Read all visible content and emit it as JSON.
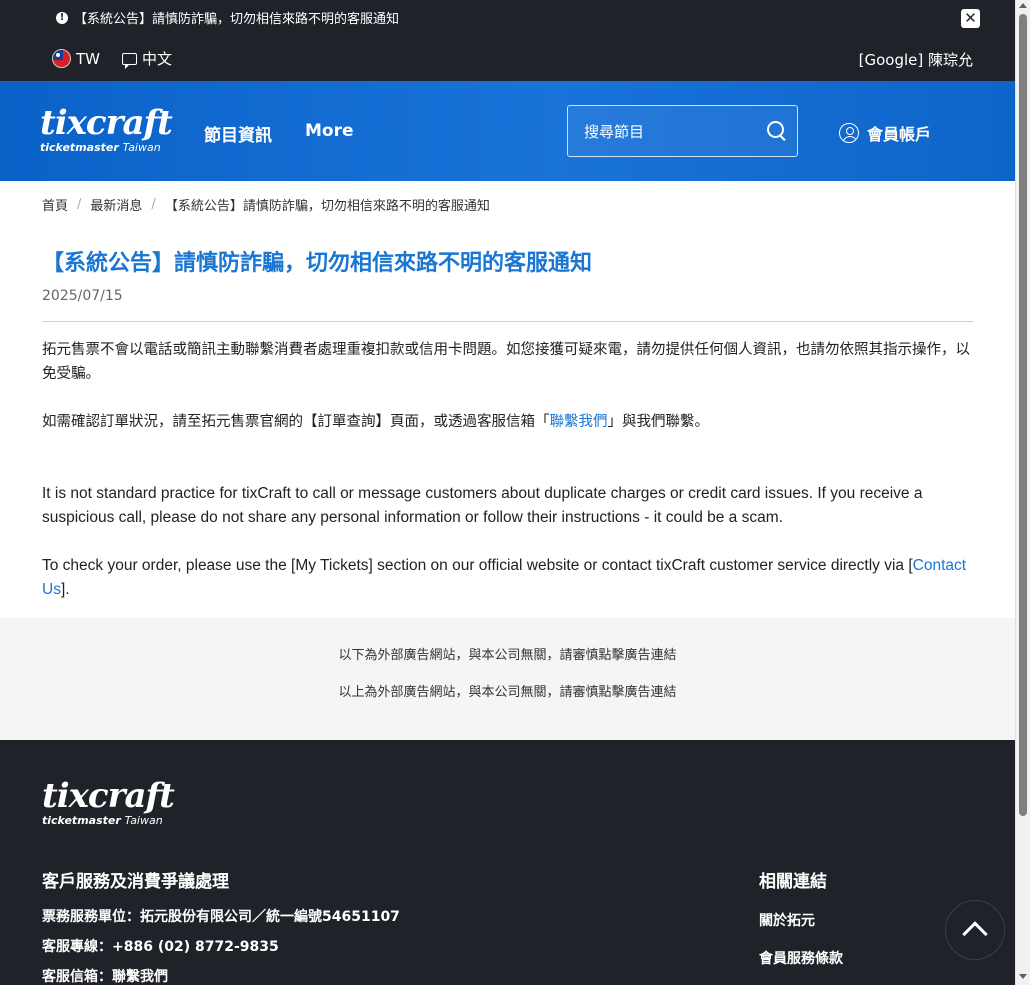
{
  "topbar": {
    "notice": "【系統公告】請慎防詐騙，切勿相信來路不明的客服通知",
    "close_label": "✕",
    "region": "TW",
    "language": "中文",
    "user": "[Google] 陳琮允"
  },
  "header": {
    "logo_main": "tixcraft",
    "logo_sub_brand": "ticketmaster",
    "logo_sub_region": "Taiwan",
    "nav": [
      "節目資訊",
      "More"
    ],
    "search_placeholder": "搜尋節目",
    "account_label": "會員帳戶"
  },
  "breadcrumb": [
    "首頁",
    "最新消息",
    "【系統公告】請慎防詐騙，切勿相信來路不明的客服通知"
  ],
  "article": {
    "title": "【系統公告】請慎防詐騙，切勿相信來路不明的客服通知",
    "date": "2025/07/15",
    "p1": "拓元售票不會以電話或簡訊主動聯繫消費者處理重複扣款或信用卡問題。如您接獲可疑來電，請勿提供任何個人資訊，也請勿依照其指示操作，以免受騙。",
    "p2_before": "如需確認訂單狀況，請至拓元售票官網的【訂單查詢】頁面，或透過客服信箱「",
    "p2_link": "聯繫我們",
    "p2_after": "」與我們聯繫。",
    "p3": "It is not standard practice for tixCraft to call or message customers about duplicate charges or credit card issues. If you receive a suspicious call, please do not share any personal information or follow their instructions - it could be a scam.",
    "p4_before": "To check your order, please use the [My Tickets] section on our official website or contact tixCraft customer service directly via [",
    "p4_link": "Contact Us",
    "p4_after": "]."
  },
  "ads": {
    "line1": "以下為外部廣告網站，與本公司無關，請審慎點擊廣告連結",
    "line2": "以上為外部廣告網站，與本公司無關，請審慎點擊廣告連結"
  },
  "footer": {
    "service_heading": "客戶服務及消費爭議處理",
    "service_lines": [
      "票務服務單位：拓元股份有限公司／統一編號54651107",
      "客服專線：+886 (02) 8772-9835",
      "客服信箱：聯繫我們"
    ],
    "links_heading": "相關連結",
    "links": [
      "關於拓元",
      "會員服務條款"
    ]
  },
  "icons": {
    "notice": "warning-icon",
    "region": "taiwan-flag-icon",
    "language": "chat-icon",
    "search": "search-icon",
    "account": "user-circle-icon",
    "back_to_top": "chevron-up-icon"
  },
  "colors": {
    "brand_blue": "#0a62c9",
    "link_blue": "#1976d2",
    "dark_bg": "#1f2329"
  }
}
